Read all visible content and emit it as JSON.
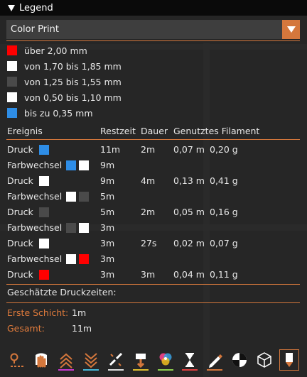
{
  "title": "Legend",
  "view_select": {
    "value": "Color Print"
  },
  "colors": {
    "accent": "#d4773c",
    "red": "#ff0000",
    "white": "#ffffff",
    "dark_gray": "#4a4a4a",
    "blue": "#2e8de6"
  },
  "legend_items": [
    {
      "label": "über 2,00 mm",
      "color": "#ff0000"
    },
    {
      "label": "von 1,70 bis 1,85 mm",
      "color": "#ffffff"
    },
    {
      "label": "von 1,25 bis 1,55 mm",
      "color": "#4a4a4a"
    },
    {
      "label": "von 0,50 bis 1,10 mm",
      "color": "#ffffff"
    },
    {
      "label": "bis zu 0,35 mm",
      "color": "#2e8de6"
    }
  ],
  "table": {
    "headers": {
      "event": "Ereignis",
      "remaining": "Restzeit",
      "duration": "Dauer",
      "filament": "Genutztes Filament"
    },
    "rows": [
      {
        "event": "Druck",
        "swatches": [
          "#2e8de6"
        ],
        "remaining": "11m",
        "duration": "2m",
        "length": "0,07 m",
        "weight": "0,20 g"
      },
      {
        "event": "Farbwechsel",
        "swatches": [
          "#2e8de6",
          "#ffffff"
        ],
        "remaining": "9m",
        "duration": "",
        "length": "",
        "weight": ""
      },
      {
        "event": "Druck",
        "swatches": [
          "#ffffff"
        ],
        "remaining": "9m",
        "duration": "4m",
        "length": "0,13 m",
        "weight": "0,41 g"
      },
      {
        "event": "Farbwechsel",
        "swatches": [
          "#ffffff",
          "#4a4a4a"
        ],
        "remaining": "5m",
        "duration": "",
        "length": "",
        "weight": ""
      },
      {
        "event": "Druck",
        "swatches": [
          "#4a4a4a"
        ],
        "remaining": "5m",
        "duration": "2m",
        "length": "0,05 m",
        "weight": "0,16 g"
      },
      {
        "event": "Farbwechsel",
        "swatches": [
          "#4a4a4a",
          "#ffffff"
        ],
        "remaining": "3m",
        "duration": "",
        "length": "",
        "weight": ""
      },
      {
        "event": "Druck",
        "swatches": [
          "#ffffff"
        ],
        "remaining": "3m",
        "duration": "27s",
        "length": "0,02 m",
        "weight": "0,07 g"
      },
      {
        "event": "Farbwechsel",
        "swatches": [
          "#ffffff",
          "#ff0000"
        ],
        "remaining": "3m",
        "duration": "",
        "length": "",
        "weight": ""
      },
      {
        "event": "Druck",
        "swatches": [
          "#ff0000"
        ],
        "remaining": "3m",
        "duration": "3m",
        "length": "0,04 m",
        "weight": "0,11 g"
      }
    ]
  },
  "estimates": {
    "heading": "Geschätzte Druckzeiten:",
    "first_layer_label": "Erste Schicht:",
    "first_layer_value": "1m",
    "total_label": "Gesamt:",
    "total_value": "11m"
  },
  "toolbar": [
    {
      "icon": "travel-moves-icon",
      "bar": ""
    },
    {
      "icon": "wipe-hand-icon",
      "bar": ""
    },
    {
      "icon": "retractions-icon",
      "bar": "#c93ad1"
    },
    {
      "icon": "deretractions-icon",
      "bar": "#46b8d8"
    },
    {
      "icon": "seams-icon",
      "bar": "#e0e0e0"
    },
    {
      "icon": "tool-changes-icon",
      "bar": "#e0c030"
    },
    {
      "icon": "color-changes-icon",
      "bar": "#8fd14f"
    },
    {
      "icon": "pause-hourglass-icon",
      "bar": "#e04040"
    },
    {
      "icon": "custom-gcode-icon",
      "bar": "#d4773c"
    },
    {
      "icon": "center-of-gravity-icon",
      "bar": ""
    },
    {
      "icon": "shells-icon",
      "bar": ""
    },
    {
      "icon": "tool-marker-icon",
      "bar": ""
    }
  ]
}
